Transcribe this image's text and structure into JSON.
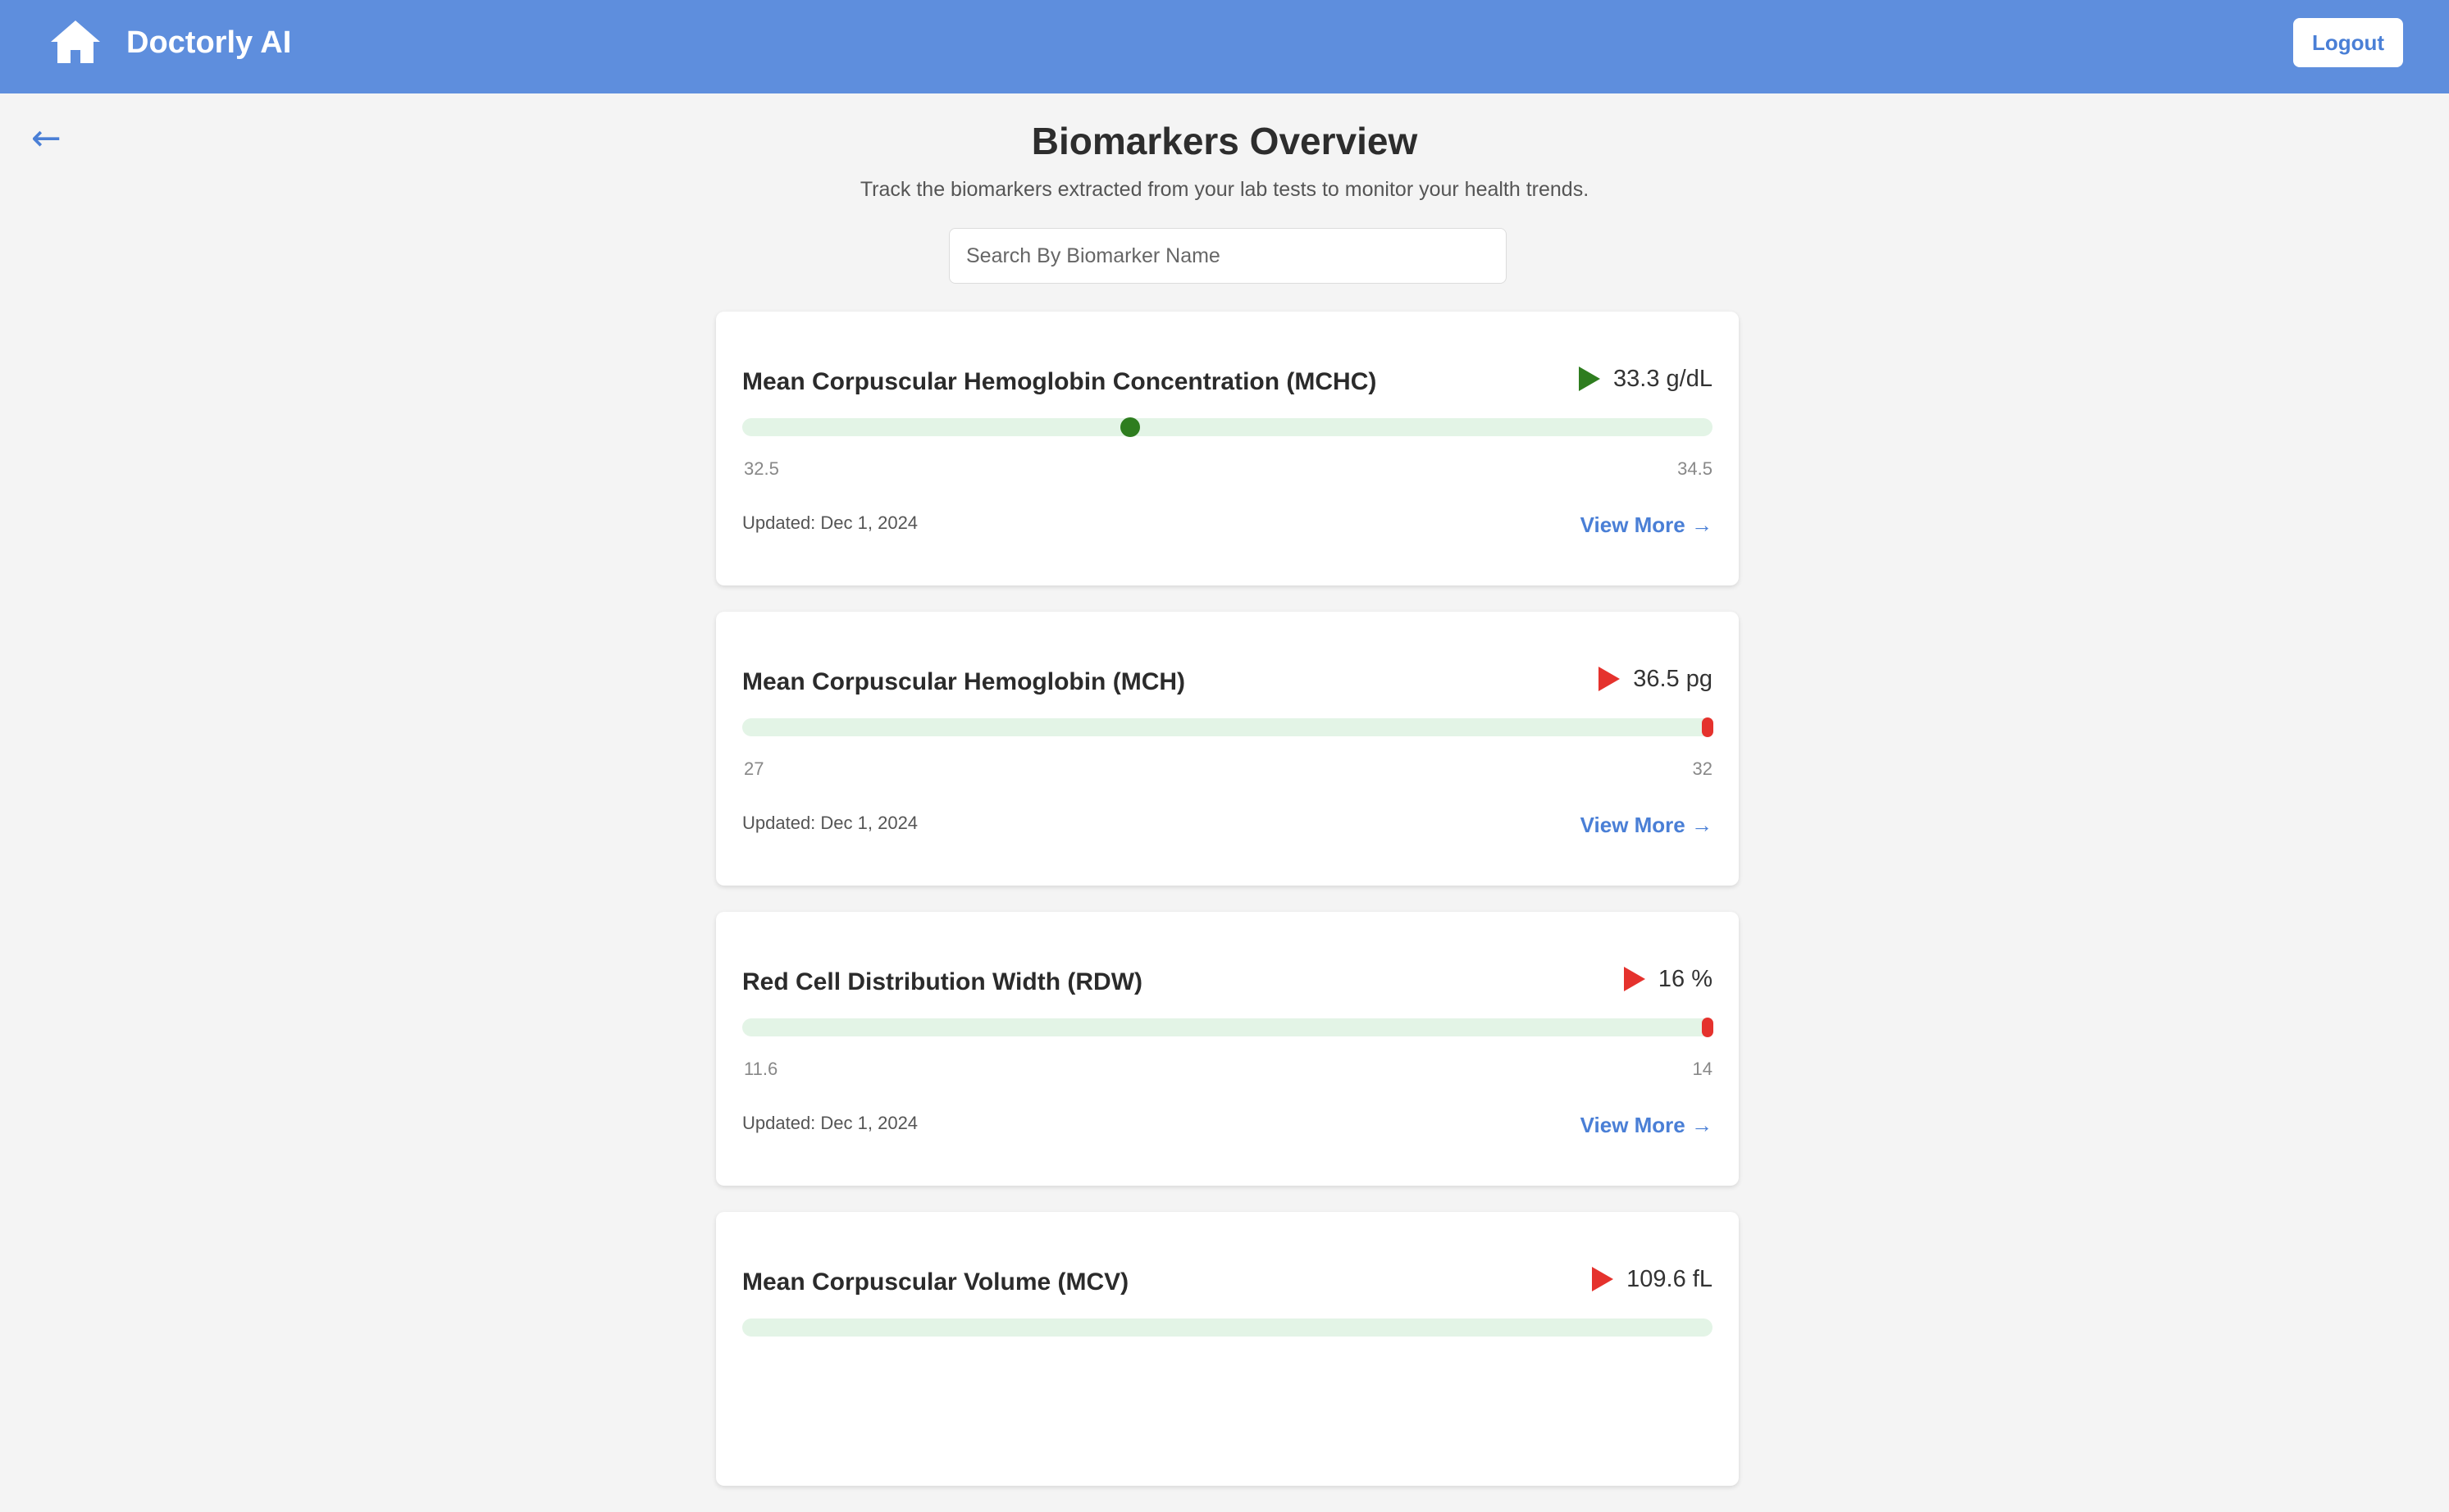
{
  "navbar": {
    "brand": "Doctorly AI",
    "logout_label": "Logout",
    "home_icon": "home-icon",
    "bg_color": "#5e8edd"
  },
  "back": {
    "label": "←"
  },
  "page": {
    "title": "Biomarkers Overview",
    "subtitle": "Track the biomarkers extracted from your lab tests to monitor your health trends."
  },
  "search": {
    "placeholder": "Search By Biomarker Name",
    "value": ""
  },
  "colors": {
    "normal": "#2e7d1f",
    "abnormal": "#e5322d",
    "accent": "#4a7fd6",
    "track": "#e3f4e6"
  },
  "biomarkers": [
    {
      "name": "Mean Corpuscular Hemoglobin Concentration (MCHC)",
      "value_text": "33.3 g/dL",
      "value": 33.3,
      "status": "normal",
      "range_min": "32.5",
      "range_max": "34.5",
      "updated": "Updated: Dec 1, 2024",
      "view_more": "View More →"
    },
    {
      "name": "Mean Corpuscular Hemoglobin (MCH)",
      "value_text": "36.5 pg",
      "value": 36.5,
      "status": "abnormal",
      "range_min": "27",
      "range_max": "32",
      "updated": "Updated: Dec 1, 2024",
      "view_more": "View More →"
    },
    {
      "name": "Red Cell Distribution Width (RDW)",
      "value_text": "16 %",
      "value": 16,
      "status": "abnormal",
      "range_min": "11.6",
      "range_max": "14",
      "updated": "Updated: Dec 1, 2024",
      "view_more": "View More →"
    },
    {
      "name": "Mean Corpuscular Volume (MCV)",
      "value_text": "109.6 fL",
      "value": 109.6,
      "status": "abnormal",
      "range_min": "",
      "range_max": "",
      "updated": "",
      "view_more": ""
    }
  ]
}
